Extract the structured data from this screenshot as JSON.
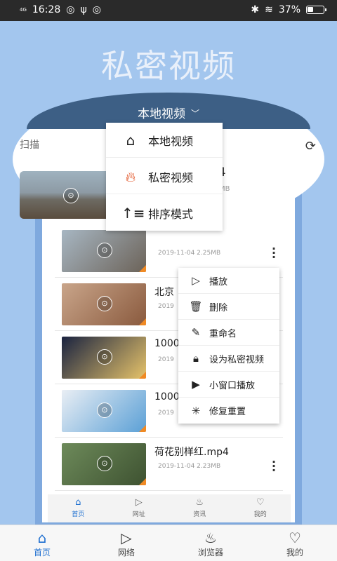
{
  "status": {
    "time": "16:28",
    "network": "4G",
    "battery": "37%",
    "icons_left": [
      "wechat-icon",
      "usb-icon",
      "cloud-icon"
    ],
    "icons_right": [
      "bluetooth-icon",
      "wifi-icon",
      "battery-icon"
    ]
  },
  "header": {
    "title": "私密视频",
    "selector_label": "本地视频",
    "scan_label": "扫描"
  },
  "dropdown": {
    "items": [
      {
        "label": "本地视频",
        "icon": "home-icon"
      },
      {
        "label": "私密视频",
        "icon": "fire-icon"
      },
      {
        "label": "排序模式",
        "icon": "sort-icon"
      }
    ]
  },
  "top_item": {
    "title": "p4",
    "meta": "MB"
  },
  "list": [
    {
      "title": "",
      "meta": "2019-11-04  2.25MB",
      "colors": [
        "#a7b6c2",
        "#6c6359"
      ]
    },
    {
      "title": "北京",
      "meta": "2019",
      "colors": [
        "#c9a58a",
        "#8a5a3e"
      ]
    },
    {
      "title": "1000",
      "meta": "2019",
      "colors": [
        "#1a2340",
        "#e6c36a"
      ]
    },
    {
      "title": "1000",
      "meta": "2019",
      "colors": [
        "#e9eef4",
        "#5ba0d6"
      ]
    },
    {
      "title": "荷花别样红.mp4",
      "meta": "2019-11-04  2.23MB",
      "colors": [
        "#6d8a5a",
        "#3e5231"
      ]
    }
  ],
  "context_menu": {
    "items": [
      {
        "label": "播放",
        "icon": "play-icon"
      },
      {
        "label": "删除",
        "icon": "trash-icon"
      },
      {
        "label": "重命名",
        "icon": "edit-icon"
      },
      {
        "label": "设为私密视频",
        "icon": "lock-icon"
      },
      {
        "label": "小窗口播放",
        "icon": "mini-window-icon"
      },
      {
        "label": "修复重置",
        "icon": "repair-icon"
      }
    ]
  },
  "inner_nav": [
    {
      "label": "首页",
      "active": true
    },
    {
      "label": "网址",
      "active": false
    },
    {
      "label": "资讯",
      "active": false
    },
    {
      "label": "我的",
      "active": false
    }
  ],
  "bottom_nav": [
    {
      "label": "首页",
      "active": true
    },
    {
      "label": "网络",
      "active": false
    },
    {
      "label": "浏览器",
      "active": false
    },
    {
      "label": "我的",
      "active": false
    }
  ]
}
